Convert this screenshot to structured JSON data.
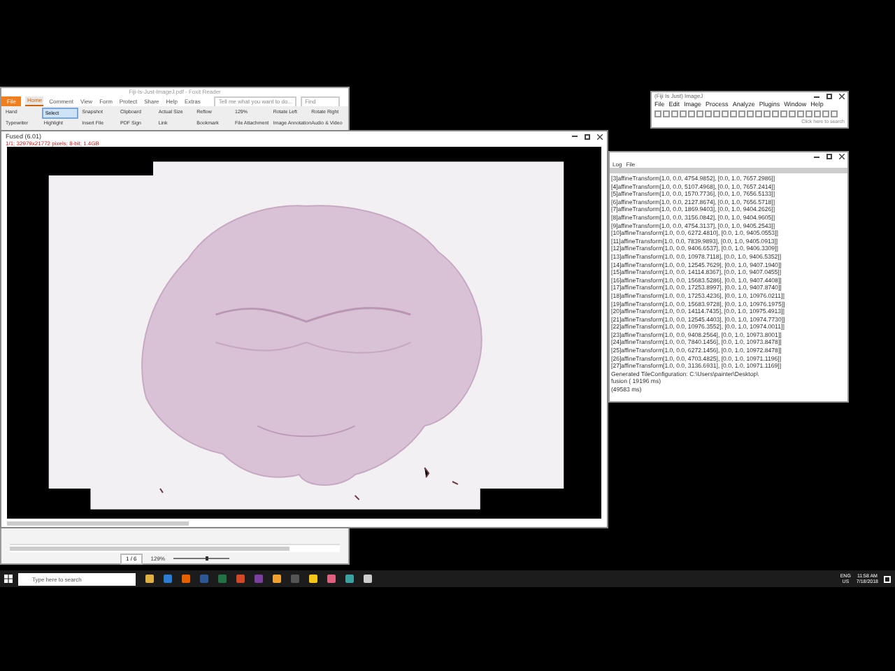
{
  "pdf_window": {
    "title": "Fiji-Is-Just-ImageJ.pdf - Foxit Reader",
    "tabs": [
      {
        "label": "File",
        "kind": "menu",
        "selected": false
      },
      {
        "label": "Home",
        "kind": "tab",
        "selected": true
      },
      {
        "label": "Comment",
        "kind": "tab",
        "selected": false
      },
      {
        "label": "View",
        "kind": "tab",
        "selected": false
      },
      {
        "label": "Form",
        "kind": "tab",
        "selected": false
      },
      {
        "label": "Protect",
        "kind": "tab",
        "selected": false
      },
      {
        "label": "Share",
        "kind": "tab",
        "selected": false
      },
      {
        "label": "Help",
        "kind": "tab",
        "selected": false
      },
      {
        "label": "Extras",
        "kind": "tab",
        "selected": false
      }
    ],
    "search_placeholder": "Tell me what you want to do...",
    "find_placeholder": "Find",
    "tools": [
      {
        "label": "Hand",
        "selected": false
      },
      {
        "label": "Select",
        "selected": true
      },
      {
        "label": "Snapshot",
        "selected": false
      },
      {
        "label": "Clipboard",
        "selected": false
      },
      {
        "label": "Actual Size",
        "selected": false
      },
      {
        "label": "Reflow",
        "selected": false
      },
      {
        "label": "129%",
        "selected": false
      },
      {
        "label": "Rotate Left",
        "selected": false
      },
      {
        "label": "Rotate Right",
        "selected": false
      },
      {
        "label": "Typewriter",
        "selected": false
      },
      {
        "label": "Highlight",
        "selected": false
      },
      {
        "label": "Insert File",
        "selected": false
      },
      {
        "label": "PDF Sign",
        "selected": false
      },
      {
        "label": "Link",
        "selected": false
      },
      {
        "label": "Bookmark",
        "selected": false
      },
      {
        "label": "File Attachment",
        "selected": false
      },
      {
        "label": "Image Annotation",
        "selected": false
      },
      {
        "label": "Audio & Video",
        "selected": false
      }
    ],
    "page": "1 / 6",
    "zoom": "129%",
    "zoom_slider": {
      "level": 0.6
    }
  },
  "image_window": {
    "title": "Fused (6.01)",
    "subtitle": "1/1; 32979x21772 pixels; 8-bit; 1.4GB"
  },
  "imagej": {
    "title": "(Fiji Is Just) ImageJ",
    "menus": [
      "File",
      "Edit",
      "Image",
      "Process",
      "Analyze",
      "Plugins",
      "Window",
      "Help"
    ],
    "status": "Click here to search"
  },
  "log": {
    "title": "Log",
    "menus": [
      "File"
    ],
    "lines": [
      "[3]affineTransform[1.0, 0.0, 4754.9852], [0.0, 1.0, 7657.2986]]",
      "[4]affineTransform[1.0, 0.0, 5107.4968], [0.0, 1.0, 7657.2414]]",
      "[5]affineTransform[1.0, 0.0, 1570.7736], [0.0, 1.0, 7656.5133]]",
      "[6]affineTransform[1.0, 0.0, 2127.8674], [0.0, 1.0, 7656.5718]]",
      "[7]affineTransform[1.0, 0.0, 1869.9403], [0.0, 1.0, 9404.2626]]",
      "[8]affineTransform[1.0, 0.0, 3156.0842], [0.0, 1.0, 9404.9605]]",
      "[9]affineTransform[1.0, 0.0, 4754.3137], [0.0, 1.0, 9405.2543]]",
      "[10]affineTransform[1.0, 0.0, 6272.4810], [0.0, 1.0, 9405.0553]]",
      "[11]affineTransform[1.0, 0.0, 7839.9893], [0.0, 1.0, 9405.0913]]",
      "[12]affineTransform[1.0, 0.0, 9406.6537], [0.0, 1.0, 9406.3309]]",
      "[13]affineTransform[1.0, 0.0, 10978.7118], [0.0, 1.0, 9406.5352]]",
      "[14]affineTransform[1.0, 0.0, 12545.7629], [0.0, 1.0, 9407.1940]]",
      "[15]affineTransform[1.0, 0.0, 14114.8367], [0.0, 1.0, 9407.0455]]",
      "[16]affineTransform[1.0, 0.0, 15683.5286], [0.0, 1.0, 9407.4408]]",
      "[17]affineTransform[1.0, 0.0, 17253.8997], [0.0, 1.0, 9407.8740]]",
      "[18]affineTransform[1.0, 0.0, 17253.4236], [0.0, 1.0, 10976.0211]]",
      "[19]affineTransform[1.0, 0.0, 15683.9728], [0.0, 1.0, 10976.1975]]",
      "[20]affineTransform[1.0, 0.0, 14114.7435], [0.0, 1.0, 10975.4913]]",
      "[21]affineTransform[1.0, 0.0, 12545.4403], [0.0, 1.0, 10974.7730]]",
      "[22]affineTransform[1.0, 0.0, 10976.3552], [0.0, 1.0, 10974.0011]]",
      "[23]affineTransform[1.0, 0.0, 9408.2564], [0.0, 1.0, 10973.8001]]",
      "[24]affineTransform[1.0, 0.0, 7840.1456], [0.0, 1.0, 10973.8478]]",
      "[25]affineTransform[1.0, 0.0, 6272.1456], [0.0, 1.0, 10972.8478]]",
      "[26]affineTransform[1.0, 0.0, 4703.4825], [0.0, 1.0, 10971.1196]]",
      "[27]affineTransform[1.0, 0.0, 3136.6931], [0.0, 1.0, 10971.1169]]",
      "Generated TileConfiguration: C:\\Users\\painter\\Desktop\\",
      "fusion ( 19196 ms)",
      "(49583 ms)"
    ]
  },
  "taskbar": {
    "search_placeholder": "Type here to search",
    "language": "ENG",
    "region": "US",
    "time": "11:58 AM",
    "date": "7/18/2018"
  }
}
